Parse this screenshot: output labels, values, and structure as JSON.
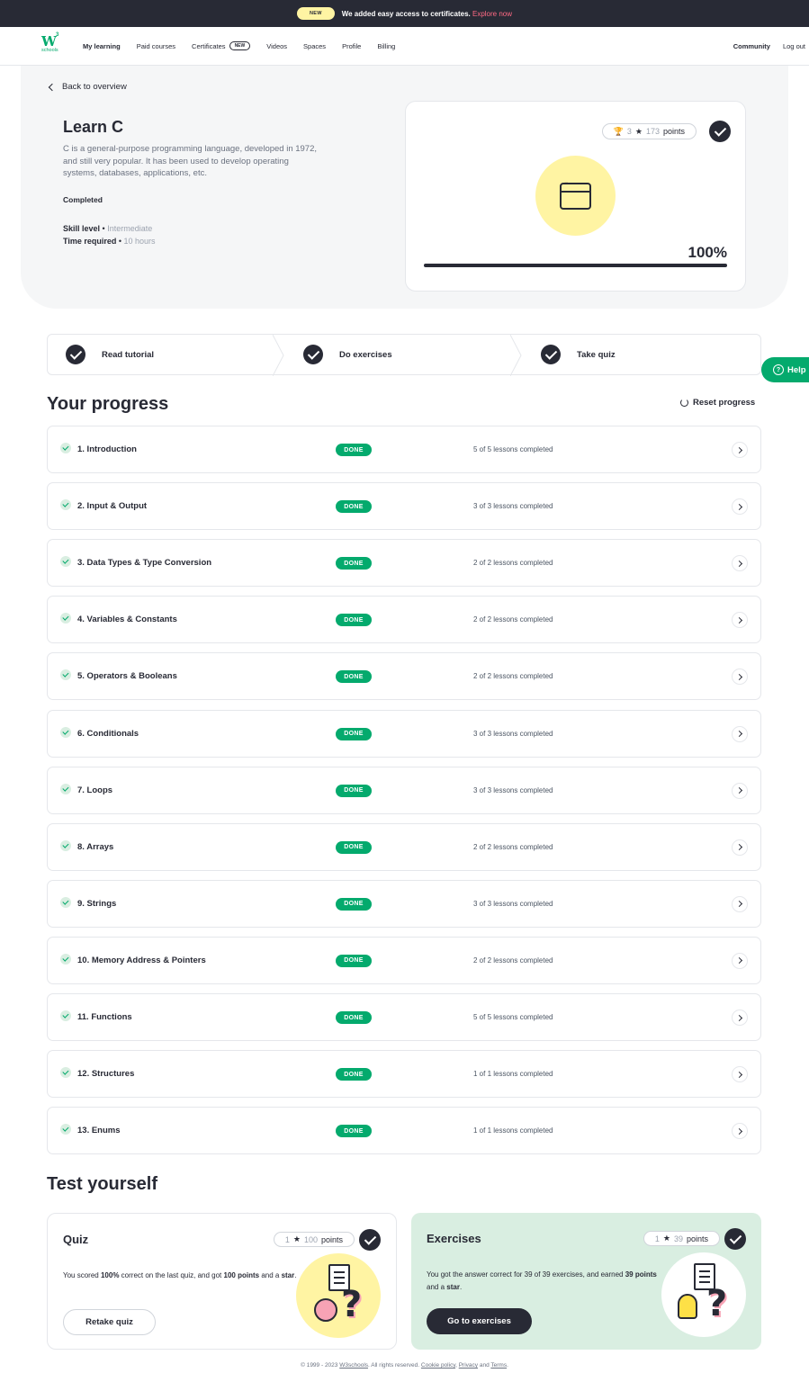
{
  "banner": {
    "new_label": "NEW",
    "message": "We added easy access to certificates.",
    "link": "Explore now"
  },
  "nav": {
    "logo_text": "W",
    "logo_sup": "3",
    "logo_sub": "schools",
    "items": [
      "My learning",
      "Paid courses",
      "Certificates",
      "Videos",
      "Spaces",
      "Profile",
      "Billing"
    ],
    "new_tag": "NEW",
    "right": [
      "Community",
      "Log out"
    ]
  },
  "hero": {
    "back": "Back to overview",
    "title": "Learn C",
    "description": "C is a general-purpose programming language, developed in 1972, and still very popular. It has been used to develop operating systems, databases, applications, etc.",
    "status": "Completed",
    "skill_label": "Skill level",
    "skill_value": "Intermediate",
    "time_label": "Time required",
    "time_value": "10 hours",
    "stars": "3",
    "points": "173",
    "points_label": "points",
    "progress_pct": 100,
    "progress_text": "100%"
  },
  "steps": [
    "Read tutorial",
    "Do exercises",
    "Take quiz"
  ],
  "progress": {
    "title": "Your progress",
    "reset": "Reset progress",
    "done_label": "DONE",
    "modules": [
      {
        "title": "1. Introduction",
        "lessons": "5 of 5 lessons completed"
      },
      {
        "title": "2. Input & Output",
        "lessons": "3 of 3 lessons completed"
      },
      {
        "title": "3. Data Types & Type Conversion",
        "lessons": "2 of 2 lessons completed"
      },
      {
        "title": "4. Variables & Constants",
        "lessons": "2 of 2 lessons completed"
      },
      {
        "title": "5. Operators & Booleans",
        "lessons": "2 of 2 lessons completed"
      },
      {
        "title": "6. Conditionals",
        "lessons": "3 of 3 lessons completed"
      },
      {
        "title": "7. Loops",
        "lessons": "3 of 3 lessons completed"
      },
      {
        "title": "8. Arrays",
        "lessons": "2 of 2 lessons completed"
      },
      {
        "title": "9. Strings",
        "lessons": "3 of 3 lessons completed"
      },
      {
        "title": "10. Memory Address & Pointers",
        "lessons": "2 of 2 lessons completed"
      },
      {
        "title": "11. Functions",
        "lessons": "5 of 5 lessons completed"
      },
      {
        "title": "12. Structures",
        "lessons": "1 of 1 lessons completed"
      },
      {
        "title": "13. Enums",
        "lessons": "1 of 1 lessons completed"
      }
    ]
  },
  "help": "Help",
  "test": {
    "title": "Test yourself",
    "quiz": {
      "title": "Quiz",
      "stars": "1",
      "points": "100",
      "points_label": "points",
      "t1": "You scored ",
      "t2": "100%",
      "t3": " correct on the last quiz, and got ",
      "t4": "100 points",
      "t5": " and a ",
      "t6": "star",
      "t7": ".",
      "button": "Retake quiz"
    },
    "exercises": {
      "title": "Exercises",
      "stars": "1",
      "points": "39",
      "points_label": "points",
      "t1": "You got the answer correct for 39 of 39 exercises, and earned ",
      "t2": "39 points",
      "t3": " and a ",
      "t4": "star",
      "t5": ".",
      "button": "Go to exercises"
    }
  },
  "footer": {
    "a": "© 1999 - 2023 ",
    "b": "W3schools",
    "c": ". All rights reserved. ",
    "d": "Cookie policy",
    "e": ", ",
    "f": "Privacy",
    "g": " and ",
    "h": "Terms",
    "i": "."
  },
  "colors": {
    "accent": "#04aa6d",
    "dark": "#282a35",
    "yellow": "#fff4a3",
    "mint": "#d9eee1"
  }
}
